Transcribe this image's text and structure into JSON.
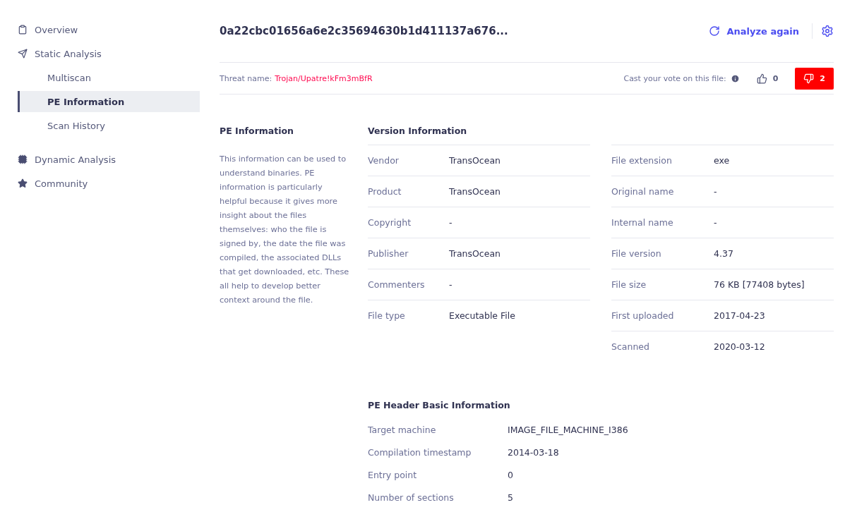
{
  "sidebar": {
    "items": [
      {
        "label": "Overview",
        "selected": false
      },
      {
        "label": "Static Analysis",
        "selected": false,
        "children": [
          {
            "label": "Multiscan",
            "selected": false
          },
          {
            "label": "PE Information",
            "selected": true
          },
          {
            "label": "Scan History",
            "selected": false
          }
        ]
      },
      {
        "label": "Dynamic Analysis",
        "selected": false
      },
      {
        "label": "Community",
        "selected": false
      }
    ]
  },
  "header": {
    "title": "0a22cbc01656a6e2c35694630b1d411137a676...",
    "action": "Analyze again"
  },
  "threat": {
    "label": "Threat name:",
    "name": "Trojan/Upatre!kFm3mBfR",
    "vote_prompt": "Cast your vote on this file:",
    "votes": [
      {
        "kind": "up",
        "count": "0",
        "selected": false
      },
      {
        "kind": "down",
        "count": "2",
        "selected": true
      }
    ]
  },
  "description": {
    "title": "PE Information",
    "text": "This information can be used to understand binaries. PE information is particularly helpful because it gives more insight about the files themselves: who the file is signed by, the date the file was compiled, the associated DLLs that get downloaded, etc. These all help to develop better context around the file."
  },
  "version_info": {
    "title": "Version Information",
    "columns": [
      [
        {
          "label": "Vendor",
          "value": "TransOcean"
        },
        {
          "label": "Product",
          "value": "TransOcean"
        },
        {
          "label": "Copyright",
          "value": "-"
        },
        {
          "label": "Publisher",
          "value": "TransOcean"
        },
        {
          "label": "Commenters",
          "value": "-"
        },
        {
          "label": "File type",
          "value": "Executable File"
        }
      ],
      [
        {
          "label": "File extension",
          "value": "exe"
        },
        {
          "label": "Original name",
          "value": "-"
        },
        {
          "label": "Internal name",
          "value": "-"
        },
        {
          "label": "File version",
          "value": "4.37"
        },
        {
          "label": "File size",
          "value": "76 KB [77408 bytes]"
        },
        {
          "label": "First uploaded",
          "value": "2017-04-23"
        },
        {
          "label": "Scanned",
          "value": "2020-03-12"
        }
      ]
    ]
  },
  "pe_header": {
    "title": "PE Header Basic Information",
    "rows": [
      {
        "label": "Target machine",
        "value": "IMAGE_FILE_MACHINE_I386"
      },
      {
        "label": "Compilation timestamp",
        "value": "2014-03-18"
      },
      {
        "label": "Entry point",
        "value": "0"
      },
      {
        "label": "Number of sections",
        "value": "5"
      }
    ]
  }
}
